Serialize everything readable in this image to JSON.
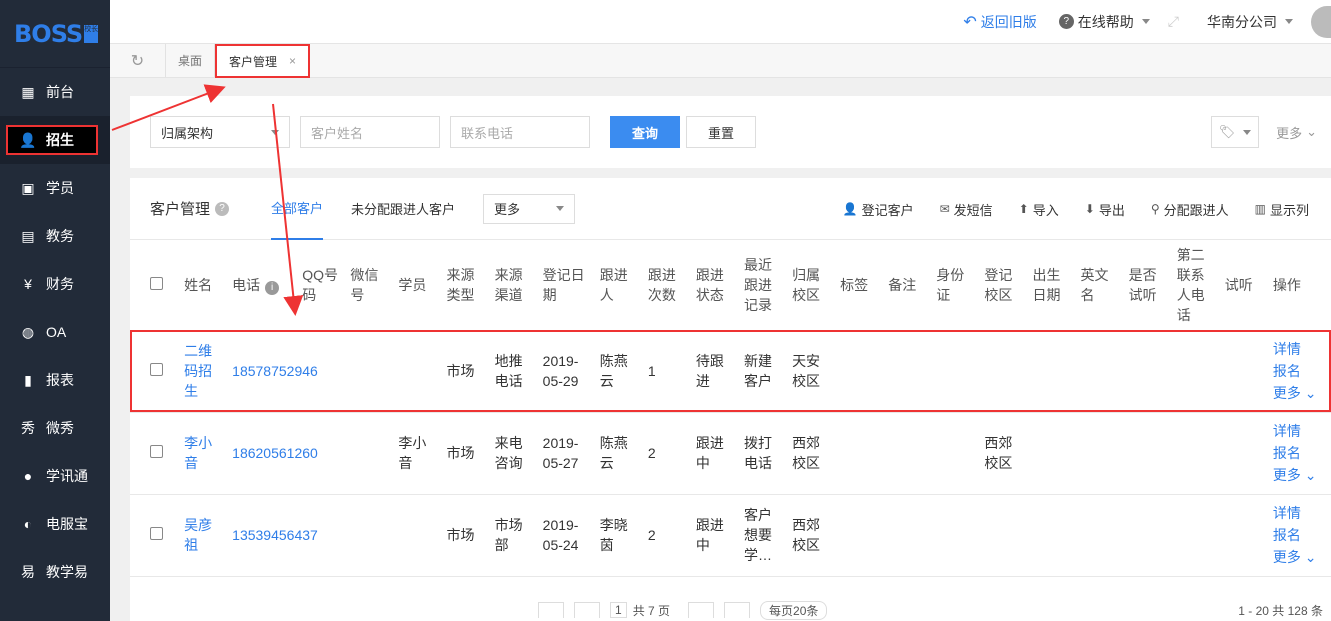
{
  "logo": {
    "text": "BOSS",
    "badge": "校长"
  },
  "sidebar": {
    "items": [
      {
        "label": "前台",
        "icon": "calendar-icon"
      },
      {
        "label": "招生",
        "icon": "add-user-icon"
      },
      {
        "label": "学员",
        "icon": "id-card-icon"
      },
      {
        "label": "教务",
        "icon": "book-icon"
      },
      {
        "label": "财务",
        "icon": "yen-icon"
      },
      {
        "label": "OA",
        "icon": "oa-icon"
      },
      {
        "label": "报表",
        "icon": "bar-chart-icon"
      },
      {
        "label": "微秀",
        "icon": "xiu-icon"
      },
      {
        "label": "学讯通",
        "icon": "location-pin-icon"
      },
      {
        "label": "电服宝",
        "icon": "phone-icon"
      },
      {
        "label": "教学易",
        "icon": "teach-icon"
      }
    ]
  },
  "topbar": {
    "back": "返回旧版",
    "help": "在线帮助",
    "branch": "华南分公司"
  },
  "tabs": {
    "desk": "桌面",
    "customer": "客户管理"
  },
  "search": {
    "org_label": "归属架构",
    "name_placeholder": "客户姓名",
    "phone_placeholder": "联系电话",
    "query_label": "查询",
    "reset_label": "重置",
    "more_label": "更多"
  },
  "card": {
    "title": "客户管理",
    "tab_all": "全部客户",
    "tab_unassigned": "未分配跟进人客户",
    "more_select": "更多",
    "actions": [
      "登记客户",
      "发短信",
      "导入",
      "导出",
      "分配跟进人",
      "显示列"
    ]
  },
  "table": {
    "headers": [
      "姓名",
      "电话",
      "QQ号码",
      "微信号",
      "学员",
      "来源类型",
      "来源渠道",
      "登记日期",
      "跟进人",
      "跟进次数",
      "跟进状态",
      "最近跟进记录",
      "归属校区",
      "标签",
      "备注",
      "身份证",
      "登记校区",
      "出生日期",
      "英文名",
      "是否试听",
      "第二联系人电话",
      "试听",
      "操作"
    ],
    "rows": [
      {
        "name": "二维码招生",
        "phone": "18578752946",
        "qq": "",
        "wechat": "",
        "student": "",
        "src_type": "市场",
        "src_channel": "地推电话",
        "date": "2019-05-29",
        "owner": "陈燕云",
        "count": "1",
        "status": "待跟进",
        "last": "新建客户",
        "campus": "天安校区",
        "reg_campus": ""
      },
      {
        "name": "李小音",
        "phone": "18620561260",
        "qq": "",
        "wechat": "",
        "student": "李小音",
        "src_type": "市场",
        "src_channel": "来电咨询",
        "date": "2019-05-27",
        "owner": "陈燕云",
        "count": "2",
        "status": "跟进中",
        "last": "拨打电话",
        "campus": "西郊校区",
        "reg_campus": "西郊校区"
      },
      {
        "name": "吴彦祖",
        "phone": "13539456437",
        "qq": "",
        "wechat": "",
        "student": "",
        "src_type": "市场",
        "src_channel": "市场部",
        "date": "2019-05-24",
        "owner": "李晓茵",
        "count": "2",
        "status": "跟进中",
        "last": "客户想要学…",
        "campus": "西郊校区",
        "reg_campus": ""
      }
    ],
    "ops": {
      "detail": "详情",
      "enroll": "报名",
      "more": "更多"
    }
  },
  "pager": {
    "page": "1",
    "total_pages": "共 7 页",
    "per_page": "每页20条",
    "range": "1 - 20  共 128 条"
  }
}
